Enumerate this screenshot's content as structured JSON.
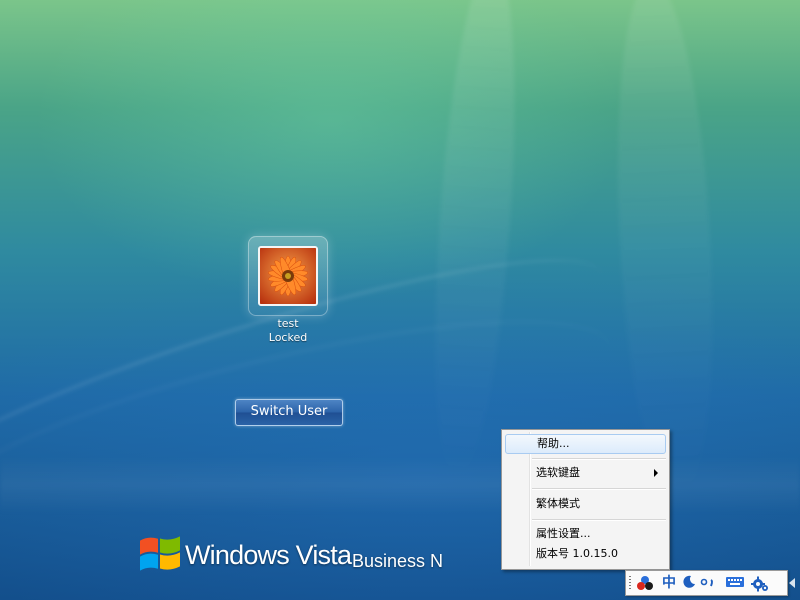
{
  "user": {
    "name": "test",
    "status": "Locked"
  },
  "switch_user_label": "Switch User",
  "branding": {
    "windows_text": "Windows Vista",
    "edition_text": "Business N"
  },
  "context_menu": {
    "items": [
      {
        "label": "帮助...",
        "highlighted": true
      },
      {
        "label": "选软键盘",
        "has_submenu": true
      },
      {
        "label": "繁体模式"
      },
      {
        "label": "属性设置..."
      },
      {
        "label": "版本号 1.0.15.0"
      }
    ]
  },
  "ime_toolbar": {
    "mode_label": "中",
    "icons": [
      "ime-logo-icon",
      "mode-chinese-icon",
      "half-width-moon-icon",
      "chinese-punctuation-icon",
      "soft-keyboard-icon",
      "settings-gear-icon",
      "collapse-arrow-icon"
    ]
  },
  "colors": {
    "accent_blue": "#1f5fbf",
    "button_blue": "#2b62a8",
    "menu_bg": "#f4f4f4",
    "menu_highlight_border": "#a8cbf1"
  }
}
